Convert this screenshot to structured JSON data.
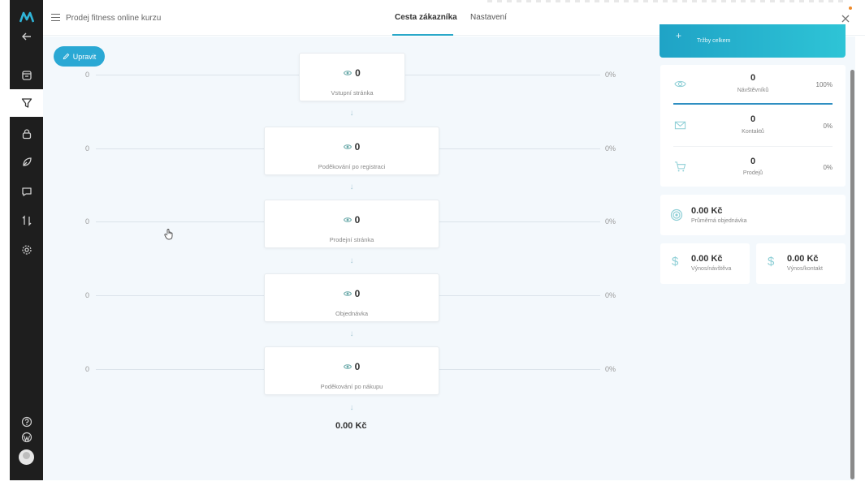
{
  "header": {
    "breadcrumb": "Prodej fitness online kurzu",
    "tabs": [
      {
        "label": "Cesta zákazníka",
        "active": true
      },
      {
        "label": "Nastavení",
        "active": false
      }
    ]
  },
  "toolbar": {
    "edit_label": "Upravit"
  },
  "funnel": {
    "steps": [
      {
        "name": "Vstupní stránka",
        "views": "0",
        "left_value": "0",
        "right_value": "0%"
      },
      {
        "name": "Poděkování po registraci",
        "views": "0",
        "left_value": "0",
        "right_value": "0%"
      },
      {
        "name": "Prodejní stránka",
        "views": "0",
        "left_value": "0",
        "right_value": "0%"
      },
      {
        "name": "Objednávka",
        "views": "0",
        "left_value": "0",
        "right_value": "0%"
      },
      {
        "name": "Poděkování po nákupu",
        "views": "0",
        "left_value": "0",
        "right_value": "0%"
      }
    ],
    "total": "0.00 Kč"
  },
  "stats": {
    "revenue_label": "Tržby celkem",
    "visitors": {
      "value": "0",
      "label": "Návštěvníků",
      "percent": "100%"
    },
    "contacts": {
      "value": "0",
      "label": "Kontaktů",
      "percent": "0%"
    },
    "sales": {
      "value": "0",
      "label": "Prodejů",
      "percent": "0%"
    },
    "avg_order": {
      "value": "0.00 Kč",
      "label": "Průměrná objednávka"
    },
    "revenue_per_visit": {
      "value": "0.00 Kč",
      "label": "Výnos/návštěva"
    },
    "revenue_per_contact": {
      "value": "0.00 Kč",
      "label": "Výnos/kontakt"
    }
  },
  "icons": {
    "sidebar": [
      "logo-icon",
      "back-arrow-icon",
      "box-icon",
      "funnel-icon",
      "lock-icon",
      "rocket-icon",
      "chat-icon",
      "transfer-icon",
      "gear-icon",
      "help-icon",
      "wordpress-icon"
    ],
    "accent": "#2aa8d4"
  }
}
